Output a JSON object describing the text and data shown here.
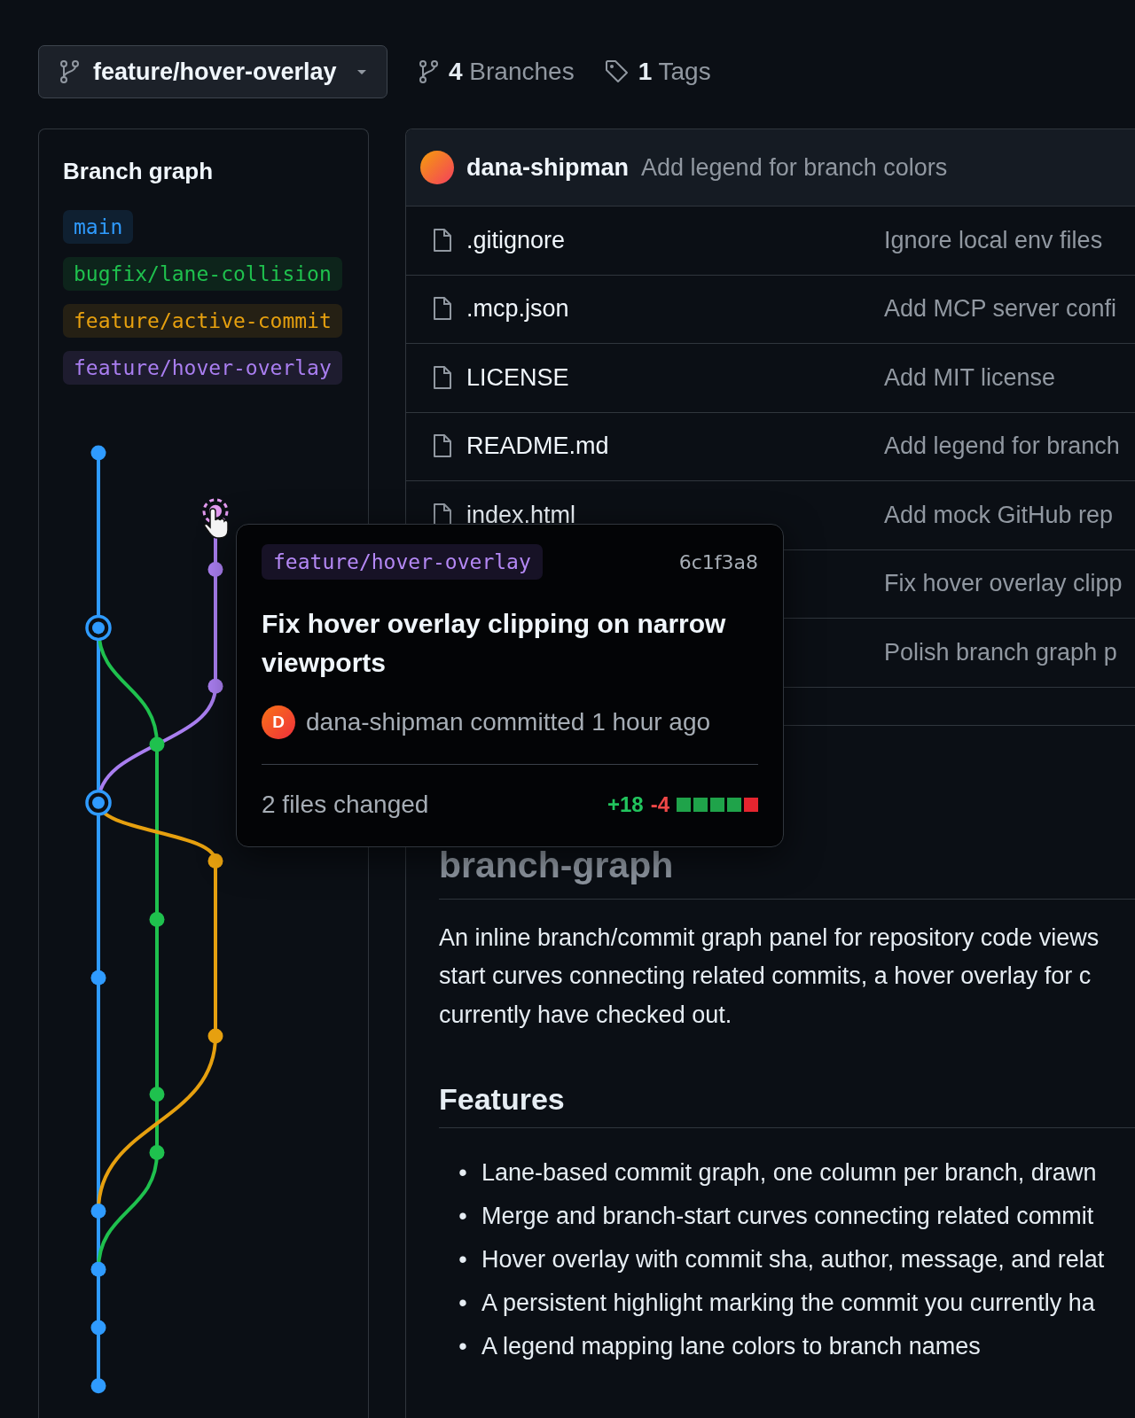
{
  "branch_selector": {
    "label": "feature/hover-overlay"
  },
  "branches_link": {
    "count": "4",
    "label": "Branches"
  },
  "tags_link": {
    "count": "1",
    "label": "Tags"
  },
  "branch_graph": {
    "title": "Branch graph",
    "branches": [
      {
        "name": "main",
        "color": "#2f9bff"
      },
      {
        "name": "bugfix/lane-collision",
        "color": "#1fc14e"
      },
      {
        "name": "feature/active-commit",
        "color": "#e6a00f"
      },
      {
        "name": "feature/hover-overlay",
        "color": "#a97ef0"
      }
    ]
  },
  "latest_commit": {
    "author": "dana-shipman",
    "message": "Add legend for branch colors"
  },
  "files": [
    {
      "name": ".gitignore",
      "message": "Ignore local env files"
    },
    {
      "name": ".mcp.json",
      "message": "Add MCP server confi"
    },
    {
      "name": "LICENSE",
      "message": "Add MIT license"
    },
    {
      "name": "README.md",
      "message": "Add legend for branch"
    },
    {
      "name": "index.html",
      "message": "Add mock GitHub rep"
    },
    {
      "message": "Fix hover overlay clipp"
    },
    {
      "message": "Polish branch graph p"
    }
  ],
  "readme": {
    "title": "branch-graph",
    "lines": [
      "An inline branch/commit graph panel for repository code views",
      "start curves connecting related commits, a hover overlay for c",
      "currently have checked out."
    ],
    "features_heading": "Features",
    "features": [
      {
        "bullet": "•",
        "text": "Lane-based commit graph, one column per branch, drawn"
      },
      {
        "bullet": "•",
        "text": "Merge and branch-start curves connecting related commit"
      },
      {
        "bullet": "•",
        "text": "Hover overlay with commit sha, author, message, and relat"
      },
      {
        "bullet": "•",
        "text": "A persistent highlight marking the commit you currently ha"
      },
      {
        "bullet": "•",
        "text": "A legend mapping lane colors to branch names"
      }
    ]
  },
  "hover_card": {
    "branch": "feature/hover-overlay",
    "sha": "6c1f3a8",
    "title": "Fix hover overlay clipping on narrow viewports",
    "avatar": "D",
    "byline": "dana-shipman committed 1 hour ago",
    "files_changed": "2 files changed",
    "additions": "+18",
    "deletions": "-4",
    "diffstat": {
      "level": 0.8
    }
  }
}
